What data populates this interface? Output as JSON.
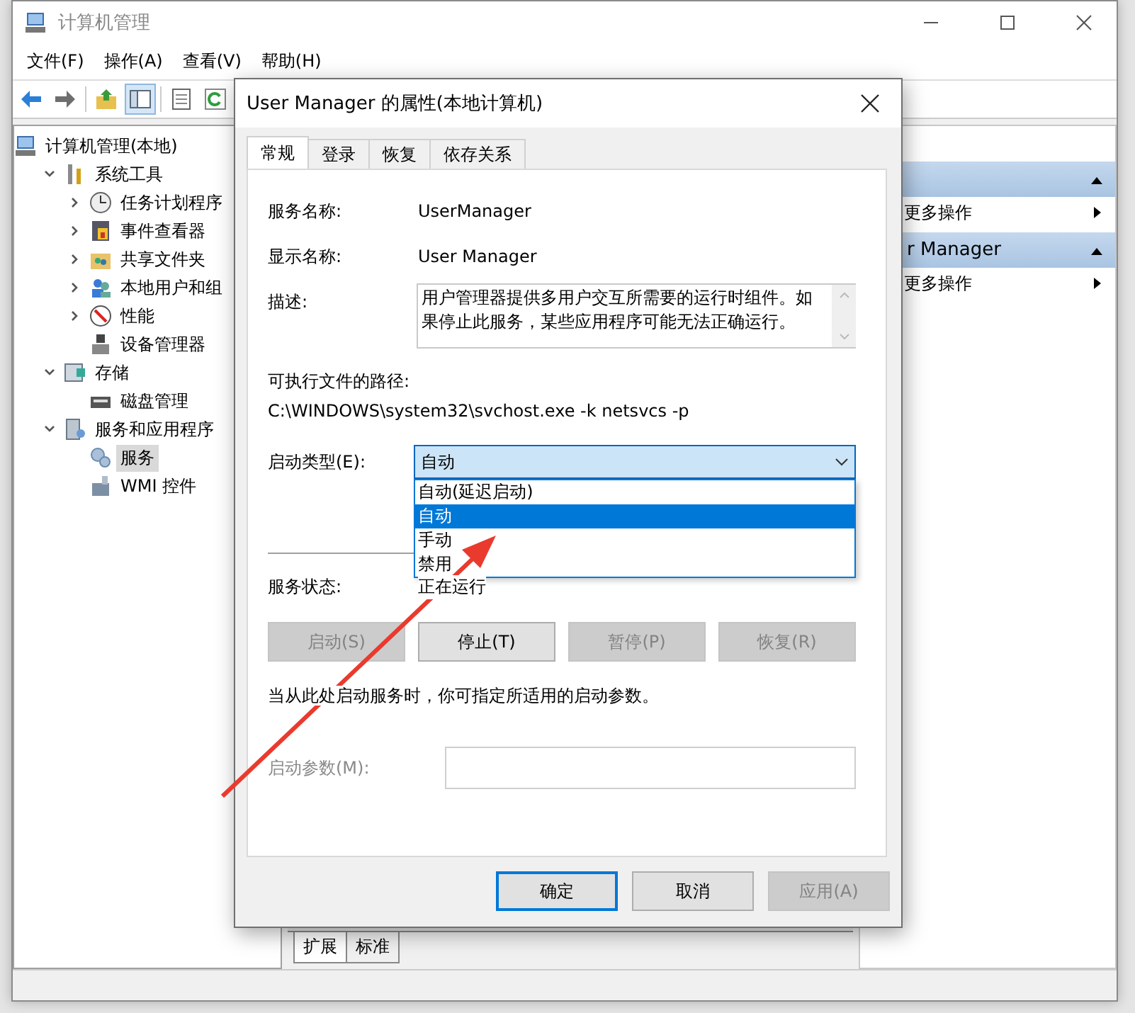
{
  "window": {
    "title": "计算机管理"
  },
  "menu": [
    {
      "label": "文件(F)"
    },
    {
      "label": "操作(A)"
    },
    {
      "label": "查看(V)"
    },
    {
      "label": "帮助(H)"
    }
  ],
  "toolbar": [
    {
      "kind": "back",
      "pressed": false
    },
    {
      "kind": "forward",
      "pressed": false
    },
    {
      "kind": "up",
      "pressed": false
    },
    {
      "kind": "tree",
      "pressed": true
    },
    {
      "kind": "properties",
      "pressed": false
    },
    {
      "kind": "refresh",
      "pressed": false
    }
  ],
  "tree": [
    {
      "label": "计算机管理(本地)",
      "kind": "computer",
      "selected": false,
      "children": [
        {
          "label": "系统工具",
          "kind": "tools",
          "expanded": true,
          "selected": false,
          "children": [
            {
              "label": "任务计划程序",
              "kind": "clock",
              "expanded": false,
              "selected": false
            },
            {
              "label": "事件查看器",
              "kind": "event",
              "expanded": false,
              "selected": false
            },
            {
              "label": "共享文件夹",
              "kind": "share",
              "expanded": false,
              "selected": false
            },
            {
              "label": "本地用户和组",
              "kind": "users",
              "expanded": false,
              "selected": false
            },
            {
              "label": "性能",
              "kind": "perf",
              "expanded": false,
              "selected": false
            },
            {
              "label": "设备管理器",
              "kind": "device",
              "selected": false
            }
          ]
        },
        {
          "label": "存储",
          "kind": "storage",
          "expanded": true,
          "selected": false,
          "children": [
            {
              "label": "磁盘管理",
              "kind": "disk",
              "selected": false
            }
          ]
        },
        {
          "label": "服务和应用程序",
          "kind": "apps",
          "expanded": true,
          "selected": false,
          "children": [
            {
              "label": "服务",
              "kind": "services",
              "selected": true
            },
            {
              "label": "WMI 控件",
              "kind": "wmi",
              "selected": false
            }
          ]
        }
      ]
    }
  ],
  "center_tabs": [
    {
      "label": "扩展",
      "selected": true
    },
    {
      "label": "标准",
      "selected": false
    }
  ],
  "actions": [
    {
      "kind": "header"
    },
    {
      "kind": "item",
      "label": "更多操作"
    },
    {
      "kind": "header",
      "label": "r Manager"
    },
    {
      "kind": "item",
      "label": "更多操作"
    }
  ],
  "dialog": {
    "title": "User Manager 的属性(本地计算机)",
    "tabs": [
      {
        "label": "常规",
        "selected": true
      },
      {
        "label": "登录",
        "selected": false
      },
      {
        "label": "恢复",
        "selected": false
      },
      {
        "label": "依存关系",
        "selected": false
      }
    ],
    "service_name": {
      "label": "服务名称:",
      "value": "UserManager"
    },
    "display_name": {
      "label": "显示名称:",
      "value": "User Manager"
    },
    "description": {
      "label": "描述:",
      "value": "用户管理器提供多用户交互所需要的运行时组件。如果停止此服务，某些应用程序可能无法正确运行。"
    },
    "path": {
      "label": "可执行文件的路径:",
      "value": "C:\\WINDOWS\\system32\\svchost.exe -k netsvcs -p"
    },
    "startup_type": {
      "label": "启动类型(E):",
      "value": "自动",
      "expanded": true,
      "options": [
        {
          "label": "自动(延迟启动)",
          "selected": false
        },
        {
          "label": "自动",
          "selected": true
        },
        {
          "label": "手动",
          "selected": false
        },
        {
          "label": "禁用",
          "selected": false
        }
      ]
    },
    "status": {
      "label": "服务状态:",
      "value": "正在运行"
    },
    "control_buttons": [
      {
        "label": "启动(S)",
        "disabled": true
      },
      {
        "label": "停止(T)",
        "disabled": false
      },
      {
        "label": "暂停(P)",
        "disabled": true
      },
      {
        "label": "恢复(R)",
        "disabled": true
      }
    ],
    "hint": "当从此处启动服务时，你可指定所适用的启动参数。",
    "parameters": {
      "label": "启动参数(M):",
      "disabled": true
    },
    "buttons": [
      {
        "label": "确定",
        "default": true,
        "disabled": false
      },
      {
        "label": "取消",
        "default": false,
        "disabled": false
      },
      {
        "label": "应用(A)",
        "default": false,
        "disabled": true
      }
    ]
  }
}
